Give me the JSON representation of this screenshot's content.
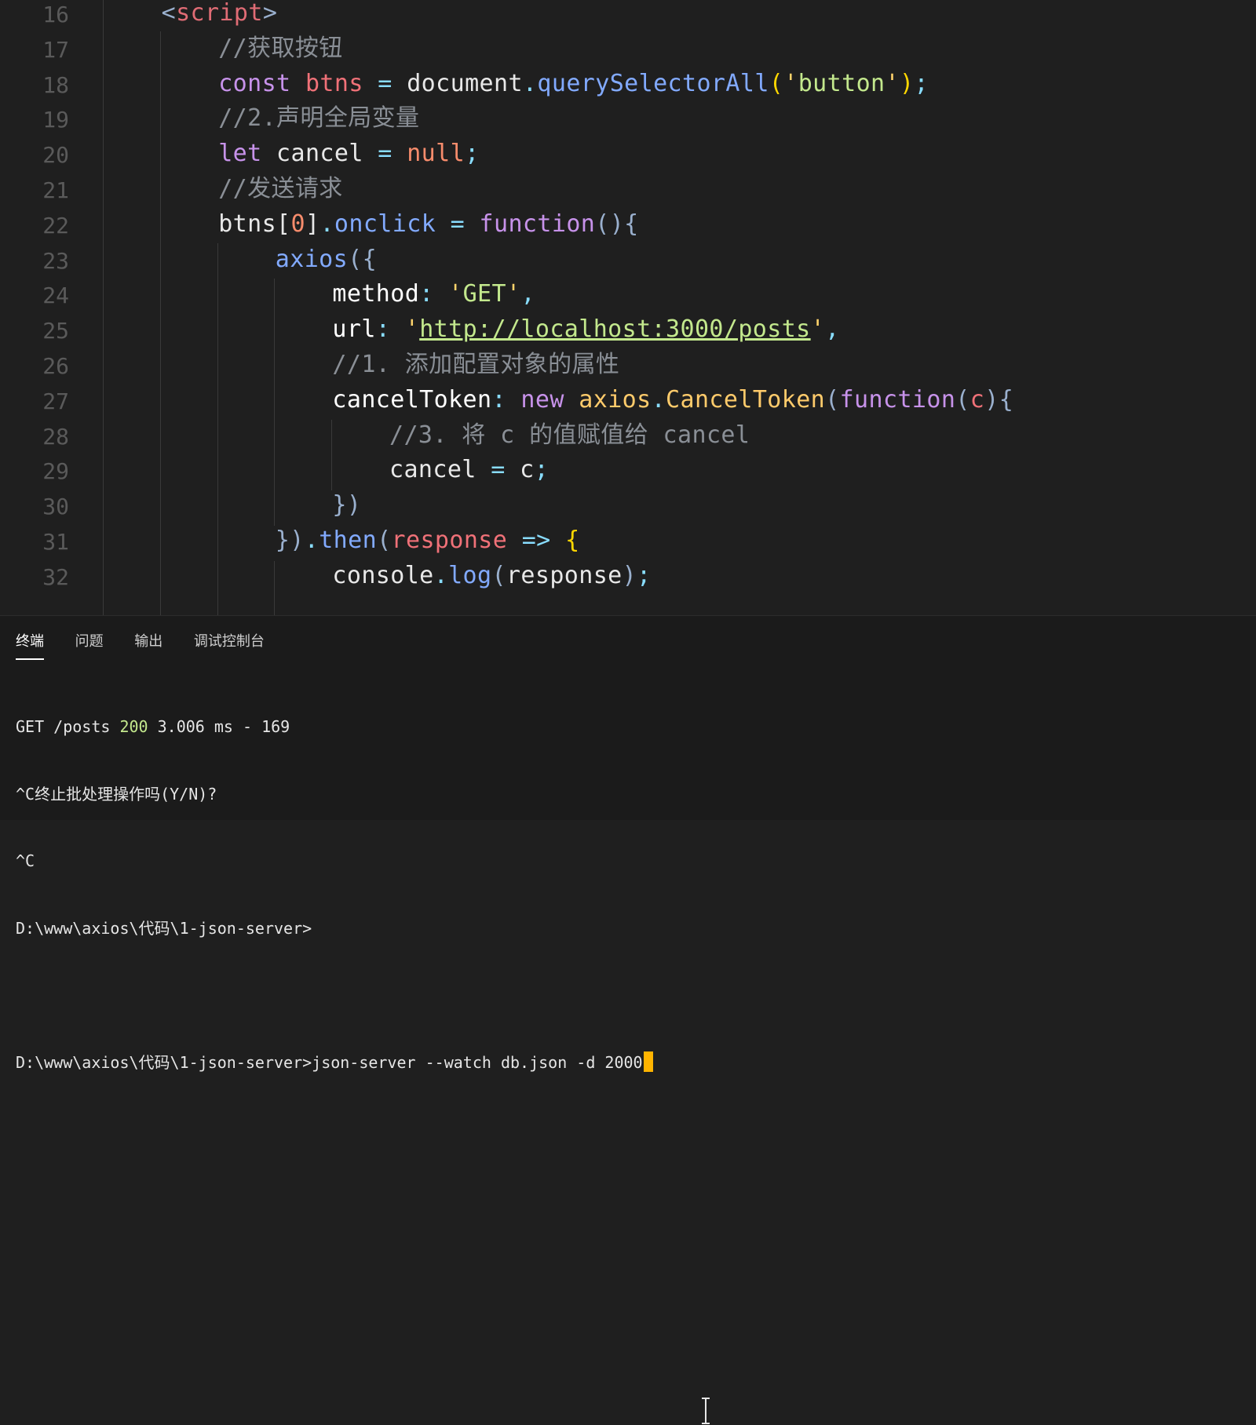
{
  "editor": {
    "lines": [
      {
        "num": "16",
        "indent": 2,
        "tokens": [
          [
            "tok-punct",
            "<"
          ],
          [
            "tok-tag",
            "script"
          ],
          [
            "tok-punct",
            ">"
          ]
        ]
      },
      {
        "num": "17",
        "indent": 4,
        "tokens": [
          [
            "tok-comment",
            "//获取按钮"
          ]
        ]
      },
      {
        "num": "18",
        "indent": 4,
        "tokens": [
          [
            "tok-keyword",
            "const "
          ],
          [
            "tok-var",
            "btns"
          ],
          [
            "tok-op",
            " = "
          ],
          [
            "tok-default",
            "document"
          ],
          [
            "tok-op",
            "."
          ],
          [
            "tok-func",
            "querySelectorAll"
          ],
          [
            "tok-bracket",
            "("
          ],
          [
            "tok-yellow",
            "'"
          ],
          [
            "tok-string",
            "button"
          ],
          [
            "tok-yellow",
            "'"
          ],
          [
            "tok-bracket",
            ")"
          ],
          [
            "tok-op",
            ";"
          ]
        ]
      },
      {
        "num": "19",
        "indent": 4,
        "tokens": [
          [
            "tok-comment",
            "//2.声明全局变量"
          ]
        ]
      },
      {
        "num": "20",
        "indent": 4,
        "tokens": [
          [
            "tok-keyword",
            "let "
          ],
          [
            "tok-default",
            "cancel"
          ],
          [
            "tok-op",
            " = "
          ],
          [
            "tok-number",
            "null"
          ],
          [
            "tok-op",
            ";"
          ]
        ]
      },
      {
        "num": "21",
        "indent": 4,
        "tokens": [
          [
            "tok-comment",
            "//发送请求"
          ]
        ]
      },
      {
        "num": "22",
        "indent": 4,
        "tokens": [
          [
            "tok-default",
            "btns"
          ],
          [
            "tok-default",
            "["
          ],
          [
            "tok-number",
            "0"
          ],
          [
            "tok-default",
            "]"
          ],
          [
            "tok-op",
            "."
          ],
          [
            "tok-func",
            "onclick"
          ],
          [
            "tok-op",
            " = "
          ],
          [
            "tok-keyword",
            "function"
          ],
          [
            "tok-punct",
            "(){"
          ]
        ]
      },
      {
        "num": "23",
        "indent": 6,
        "tokens": [
          [
            "tok-func",
            "axios"
          ],
          [
            "tok-punct",
            "({"
          ]
        ]
      },
      {
        "num": "24",
        "indent": 8,
        "tokens": [
          [
            "tok-prop",
            "method"
          ],
          [
            "tok-op",
            ": "
          ],
          [
            "tok-yellow",
            "'"
          ],
          [
            "tok-string",
            "GET"
          ],
          [
            "tok-yellow",
            "'"
          ],
          [
            "tok-op",
            ","
          ]
        ]
      },
      {
        "num": "25",
        "indent": 8,
        "tokens": [
          [
            "tok-prop",
            "url"
          ],
          [
            "tok-op",
            ": "
          ],
          [
            "tok-yellow",
            "'"
          ],
          [
            "tok-link",
            "http://localhost:3000/posts"
          ],
          [
            "tok-yellow",
            "'"
          ],
          [
            "tok-op",
            ","
          ]
        ]
      },
      {
        "num": "26",
        "indent": 8,
        "tokens": [
          [
            "tok-comment",
            "//1. 添加配置对象的属性"
          ]
        ]
      },
      {
        "num": "27",
        "indent": 8,
        "tokens": [
          [
            "tok-prop",
            "cancelToken"
          ],
          [
            "tok-op",
            ": "
          ],
          [
            "tok-keyword",
            "new "
          ],
          [
            "tok-class",
            "axios"
          ],
          [
            "tok-op",
            "."
          ],
          [
            "tok-class",
            "CancelToken"
          ],
          [
            "tok-punct",
            "("
          ],
          [
            "tok-keyword",
            "function"
          ],
          [
            "tok-punct",
            "("
          ],
          [
            "tok-var",
            "c"
          ],
          [
            "tok-punct",
            "){"
          ]
        ]
      },
      {
        "num": "28",
        "indent": 10,
        "tokens": [
          [
            "tok-comment",
            "//3. 将 c 的值赋值给 cancel"
          ]
        ]
      },
      {
        "num": "29",
        "indent": 10,
        "tokens": [
          [
            "tok-default",
            "cancel"
          ],
          [
            "tok-op",
            " = "
          ],
          [
            "tok-default",
            "c"
          ],
          [
            "tok-op",
            ";"
          ]
        ]
      },
      {
        "num": "30",
        "indent": 8,
        "tokens": [
          [
            "tok-punct",
            "})"
          ]
        ]
      },
      {
        "num": "31",
        "indent": 6,
        "tokens": [
          [
            "tok-punct",
            "})"
          ],
          [
            "tok-op",
            "."
          ],
          [
            "tok-func",
            "then"
          ],
          [
            "tok-punct",
            "("
          ],
          [
            "tok-var",
            "response"
          ],
          [
            "tok-op",
            " => "
          ],
          [
            "tok-bracket",
            "{"
          ]
        ]
      },
      {
        "num": "32",
        "indent": 8,
        "tokens": [
          [
            "tok-default",
            "console"
          ],
          [
            "tok-op",
            "."
          ],
          [
            "tok-func",
            "log"
          ],
          [
            "tok-punct",
            "("
          ],
          [
            "tok-default",
            "response"
          ],
          [
            "tok-punct",
            ")"
          ],
          [
            "tok-op",
            ";"
          ]
        ]
      }
    ]
  },
  "panel": {
    "tabs": [
      {
        "label": "终端",
        "active": true
      },
      {
        "label": "问题",
        "active": false
      },
      {
        "label": "输出",
        "active": false
      },
      {
        "label": "调试控制台",
        "active": false
      }
    ],
    "terminal": {
      "line1_prefix": "GET /posts ",
      "line1_status": "200",
      "line1_suffix": " 3.006 ms - 169",
      "line2": "^C终止批处理操作吗(Y/N)?",
      "line3": "^C",
      "line4": "D:\\www\\axios\\代码\\1-json-server>",
      "line5": "",
      "line6": "D:\\www\\axios\\代码\\1-json-server>json-server --watch db.json -d 2000"
    }
  },
  "colors": {
    "background": "#1f1f1f",
    "terminal_cursor": "#ffb400",
    "status_ok": "#c3e88d"
  }
}
